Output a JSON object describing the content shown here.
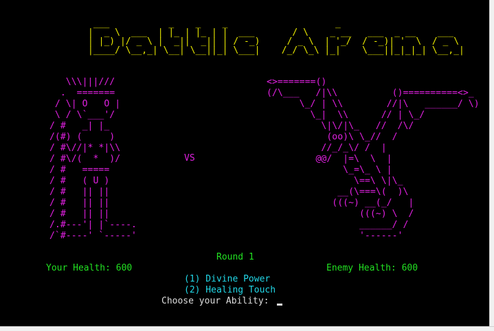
{
  "title_ascii": " ___           _    _    _                    _                          \n|  _ \\  ___  | |_ | |_ | |  ___       / \\    _ __   ___  _ __    ___ \n| |_) |/ _ \\ |  _||  _|| | / -_)     / _ \\  | '_/  / -_)| '  \\  / _ \\\n|____/ \\__,_| \\__| \\__||_| \\___|    /_/ \\_\\ |_|    \\___||_|_|_| \\__,_|",
  "warrior_ascii": "    \\\\\\|||///\n   .  =======\n  / \\| O   O |\n  \\ / \\`___'/\n / #   _| |_\n /(#) (     )\n / #\\//|* *|\\\\\n / #\\/(  *  )/\n / #   =====\n / #   ( U )\n / #   || ||\n / #   || ||\n / #   || ||\n /.#---'| |`----.\n /`#----' `-----'",
  "dragon_ascii": "<>=======()\n(/\\___   /|\\\\          ()==========<>_\n      \\_/ | \\\\        //|\\   ______/ \\)\n        \\_|  \\\\      // | \\_/\n          \\|\\/|\\_   //  /\\/\n           (oo)\\ \\_//  /\n          //_/_\\/ /  |\n         @@/  |=\\  \\  |\n              \\_=\\_ \\ |\n                \\==\\ \\|\\_\n             __(\\===\\(  )\\\n            (((~) __(_/   |\n                 (((~) \\  /\n                 ______/ /\n                 '------'",
  "vs_label": "VS",
  "round_label": "Round 1",
  "your_health": "Your Health: 600",
  "enemy_health": "Enemy Health: 600",
  "ability_options": [
    "(1) Divine Power",
    "(2) Healing Touch"
  ],
  "prompt": "Choose your Ability: ",
  "colors": {
    "background": "#000000",
    "title": "#e8e800",
    "ascii_art": "#e020e0",
    "status": "#22e022",
    "options": "#22d8e8",
    "prompt": "#dcdcdc"
  }
}
